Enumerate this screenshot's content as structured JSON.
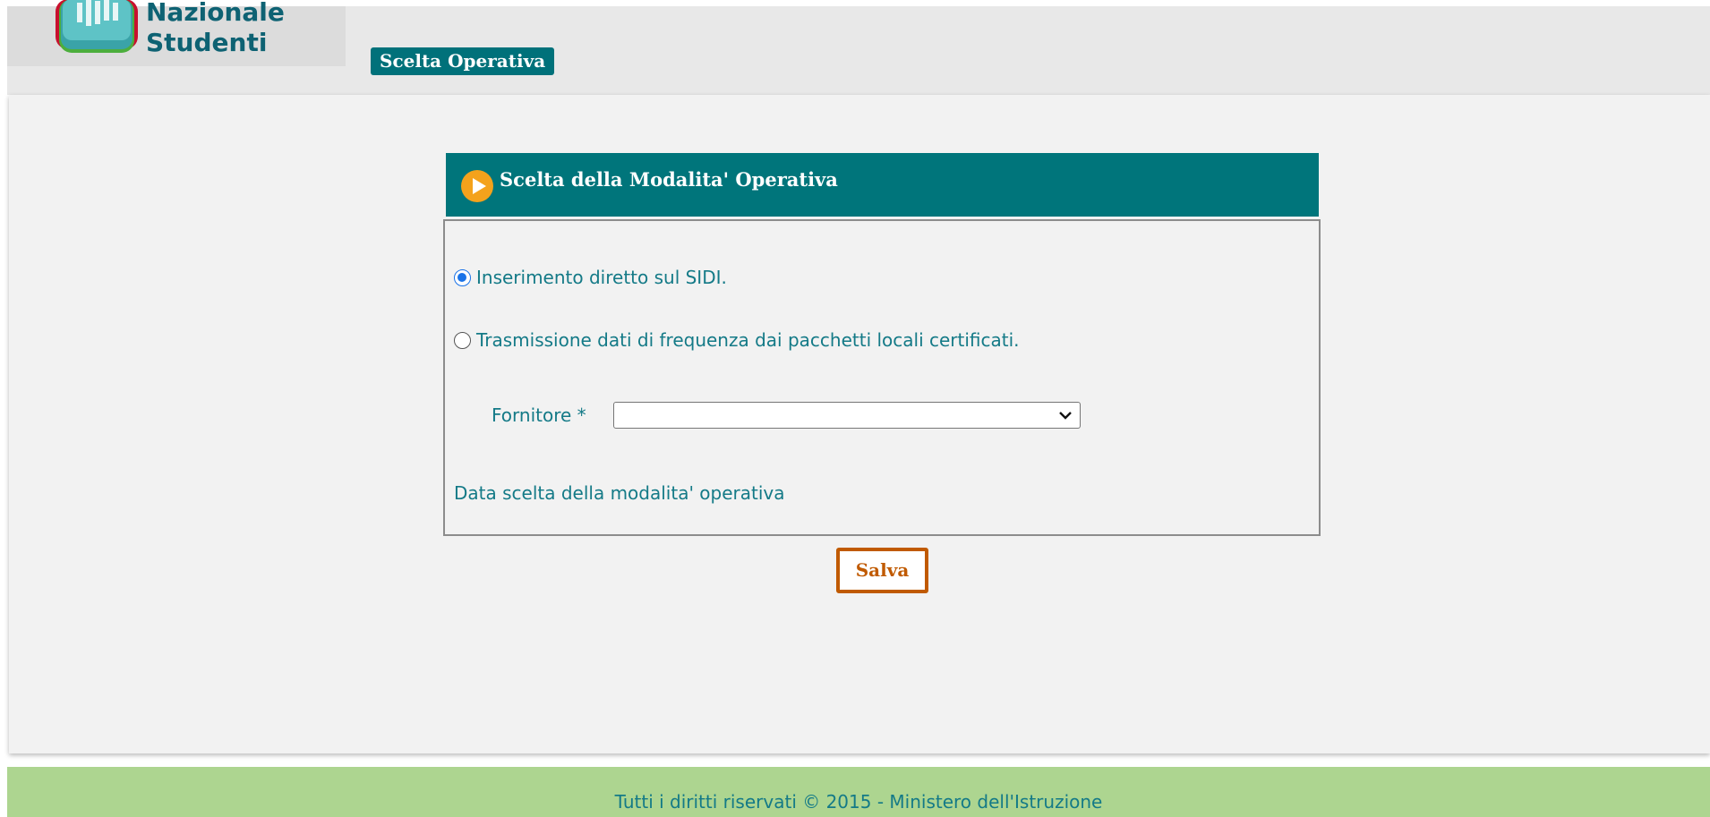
{
  "header": {
    "logo": {
      "line1": "Nazionale",
      "line2": "Studenti"
    },
    "nav_tab": "Scelta Operativa"
  },
  "panel": {
    "title": "Scelta della Modalita' Operativa",
    "options": [
      {
        "label": "Inserimento diretto sul SIDI.",
        "selected": true
      },
      {
        "label": "Trasmissione dati di frequenza dai pacchetti locali certificati.",
        "selected": false
      }
    ],
    "fornitore": {
      "label": "Fornitore *",
      "value": ""
    },
    "data_label": "Data scelta della modalita' operativa"
  },
  "save_button": "Salva",
  "footer": {
    "text": "Tutti i diritti riservati © 2015 -  Ministero dell'Istruzione"
  },
  "colors": {
    "teal_header": "#00757b",
    "nav_tab": "#00717a",
    "text_teal": "#147a87",
    "save_orange": "#c05a00",
    "footer_green": "#add590",
    "content_bg": "#f2f2f2",
    "radio_blue": "#1a73e8"
  },
  "icons": {
    "logo": "logo-icon",
    "panel": "play-icon",
    "select": "chevron-down-icon"
  }
}
